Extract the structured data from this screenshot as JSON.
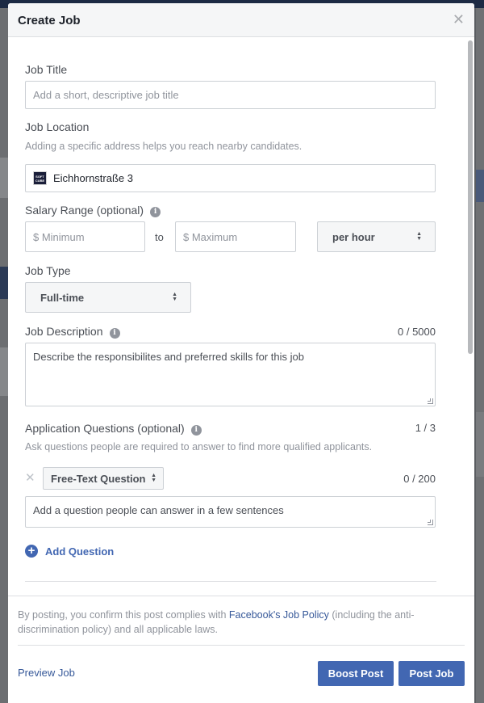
{
  "modal": {
    "title": "Create Job",
    "close_icon": "close-icon"
  },
  "form": {
    "job_title": {
      "label": "Job Title",
      "placeholder": "Add a short, descriptive job title"
    },
    "job_location": {
      "label": "Job Location",
      "help": "Adding a specific address helps you reach nearby candidates.",
      "value": "Eichhornstraße 3",
      "logo_text": [
        "SOFT",
        "CUBE"
      ]
    },
    "salary": {
      "label": "Salary Range (optional)",
      "min_placeholder": "$ Minimum",
      "to": "to",
      "max_placeholder": "$ Maximum",
      "period": "per hour"
    },
    "job_type": {
      "label": "Job Type",
      "value": "Full-time"
    },
    "job_description": {
      "label": "Job Description",
      "counter": "0 / 5000",
      "placeholder": "Describe the responsibilites and preferred skills for this job"
    },
    "application_questions": {
      "label": "Application Questions (optional)",
      "counter": "1 / 3",
      "help": "Ask questions people are required to answer to find more qualified applicants.",
      "question_type": "Free-Text Question",
      "question_counter": "0 / 200",
      "question_placeholder": "Add a question people can answer in a few sentences",
      "add_label": "Add Question"
    }
  },
  "footer": {
    "policy_prefix": "By posting, you confirm this post complies with ",
    "policy_link": "Facebook's Job Policy",
    "policy_suffix": " (including the anti-discrimination policy) and all applicable laws.",
    "preview_label": "Preview Job",
    "boost_label": "Boost Post",
    "post_label": "Post Job"
  },
  "colors": {
    "accent": "#4267b2",
    "link": "#365899",
    "header_bg": "#f5f6f7"
  }
}
